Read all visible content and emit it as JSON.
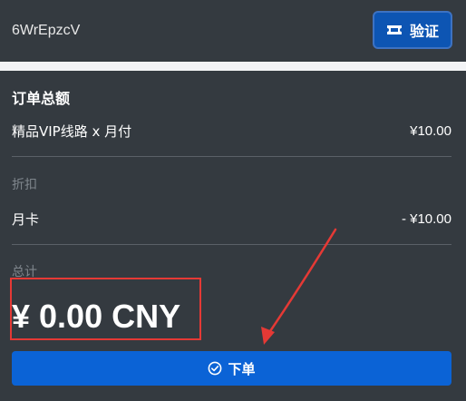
{
  "coupon": {
    "code_value": "6WrEpzcV",
    "verify_label": "验证",
    "verify_icon": "ticket-icon"
  },
  "summary": {
    "title": "订单总额",
    "item": {
      "name": "精品VIP线路 x 月付",
      "price": "¥10.00"
    },
    "discount": {
      "label": "折扣",
      "name": "月卡",
      "amount": "- ¥10.00"
    },
    "total": {
      "label": "总计",
      "amount": "¥ 0.00 CNY"
    },
    "order_button": {
      "label": "下单",
      "icon": "check-circle-icon"
    }
  },
  "annotation": {
    "highlight_color": "#e53935",
    "arrow_color": "#e53935"
  },
  "colors": {
    "panel_bg": "#343a40",
    "page_bg": "#f3f4f6",
    "primary": "#0b63d6",
    "verify_bg": "#0d55b3",
    "muted_text": "#7f868d"
  }
}
